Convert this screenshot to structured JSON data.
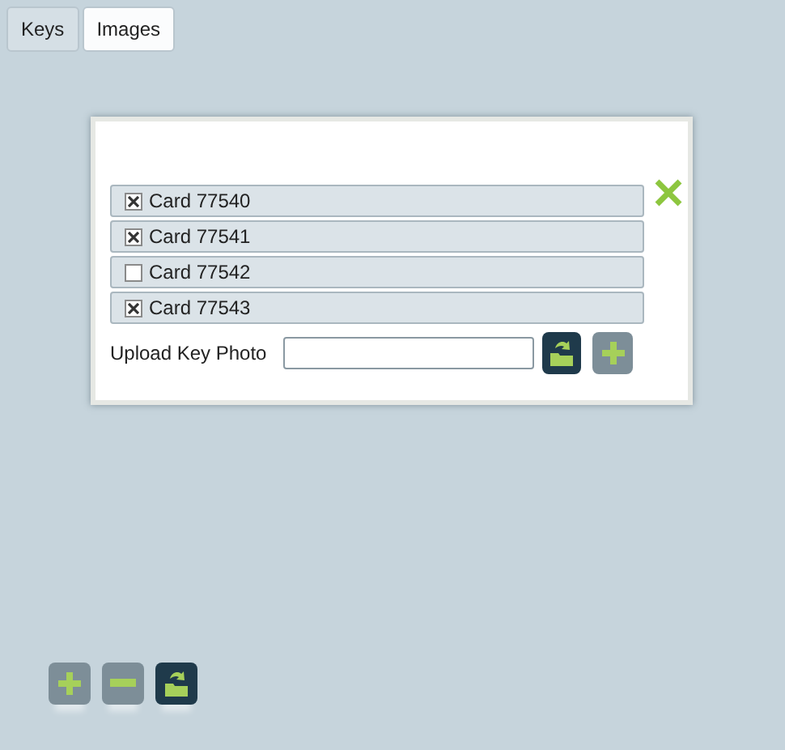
{
  "tabs": [
    {
      "label": "Keys",
      "selected": false
    },
    {
      "label": "Images",
      "selected": true
    }
  ],
  "dialog": {
    "cards": [
      {
        "label": "Card 77540",
        "checked": true
      },
      {
        "label": "Card 77541",
        "checked": true
      },
      {
        "label": "Card 77542",
        "checked": false
      },
      {
        "label": "Card 77543",
        "checked": true
      }
    ],
    "upload": {
      "label": "Upload Key Photo",
      "buttons": [
        {
          "kind": "upload"
        },
        {
          "kind": "add"
        }
      ]
    }
  },
  "toolbar": [
    {
      "kind": "add"
    },
    {
      "kind": "remove"
    },
    {
      "kind": "upload"
    }
  ]
}
